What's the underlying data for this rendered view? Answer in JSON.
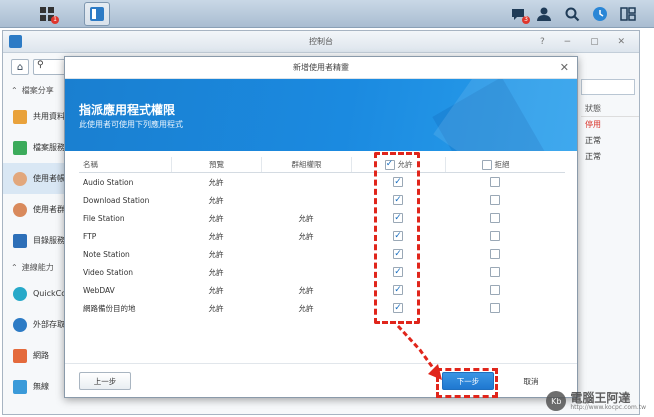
{
  "taskbar": {
    "notification_count": "1",
    "message_count": "3"
  },
  "control_panel": {
    "title": "控制台",
    "sidebar": {
      "section_file": "檔案分享",
      "items_file": [
        "共用資料夾",
        "檔案服務",
        "使用者帳號",
        "使用者群組",
        "目錄服務"
      ],
      "section_connect": "連線能力",
      "items_connect": [
        "QuickConnect",
        "外部存取",
        "網路",
        "無線"
      ]
    },
    "right_column": {
      "header": "狀態",
      "rows": [
        "停用",
        "正常",
        "正常"
      ]
    }
  },
  "wizard": {
    "title": "新增使用者精靈",
    "heading": "指派應用程式權限",
    "subheading": "此使用者可使用下列應用程式",
    "columns": {
      "name": "名稱",
      "preview": "預覽",
      "group": "群組權限",
      "allow": "允許",
      "deny": "拒絕"
    },
    "rows": [
      {
        "name": "Audio Station",
        "preview": "允許",
        "group": "",
        "allow": true,
        "deny": false
      },
      {
        "name": "Download Station",
        "preview": "允許",
        "group": "",
        "allow": true,
        "deny": false
      },
      {
        "name": "File Station",
        "preview": "允許",
        "group": "允許",
        "allow": true,
        "deny": false
      },
      {
        "name": "FTP",
        "preview": "允許",
        "group": "允許",
        "allow": true,
        "deny": false
      },
      {
        "name": "Note Station",
        "preview": "允許",
        "group": "",
        "allow": true,
        "deny": false
      },
      {
        "name": "Video Station",
        "preview": "允許",
        "group": "",
        "allow": true,
        "deny": false
      },
      {
        "name": "WebDAV",
        "preview": "允許",
        "group": "允許",
        "allow": true,
        "deny": false
      },
      {
        "name": "網路備份目的地",
        "preview": "允許",
        "group": "允許",
        "allow": true,
        "deny": false
      }
    ],
    "buttons": {
      "prev": "上一步",
      "next": "下一步",
      "cancel": "取消"
    }
  },
  "watermark": {
    "logo_text": "Kb",
    "title": "電腦王阿達",
    "url": "http://www.kocpc.com.tw"
  },
  "colors": {
    "banner": "#1b8ae0",
    "highlight": "#e0251b",
    "primary_button": "#1f78d0"
  }
}
